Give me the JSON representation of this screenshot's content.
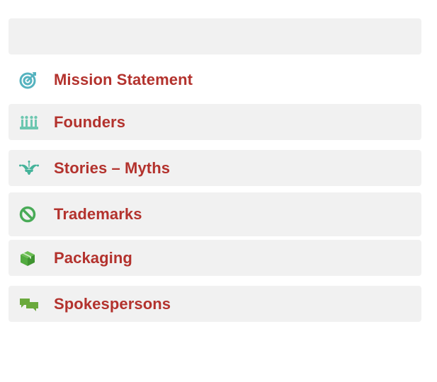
{
  "menu": {
    "items": [
      {
        "label": "Mission Statement",
        "icon": "target-icon",
        "color": "#55b3bf"
      },
      {
        "label": "Founders",
        "icon": "founders-icon",
        "color": "#6dc7b0"
      },
      {
        "label": "Stories – Myths",
        "icon": "jester-hat-icon",
        "color": "#45b39a"
      },
      {
        "label": "Trademarks",
        "icon": "prohibited-icon",
        "color": "#49ab57"
      },
      {
        "label": "Packaging",
        "icon": "package-box-icon",
        "color": "#52ab3f"
      },
      {
        "label": "Spokespersons",
        "icon": "speech-bubbles-icon",
        "color": "#6aa93c"
      }
    ],
    "label_color": "#b3322d"
  }
}
